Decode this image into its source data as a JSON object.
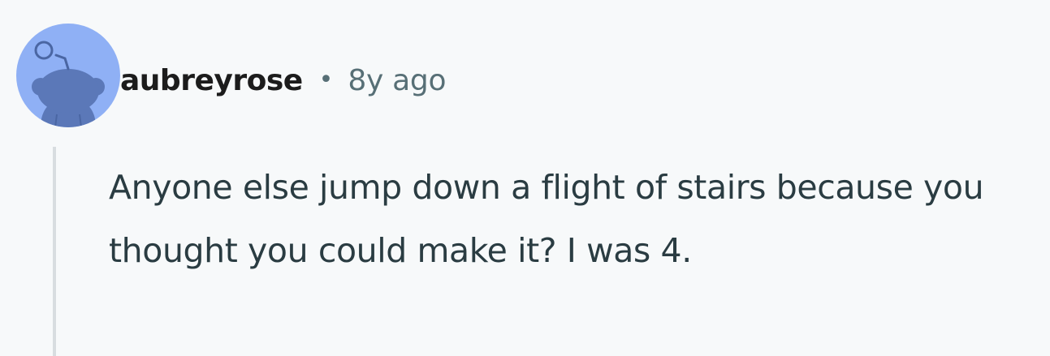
{
  "comment": {
    "author": "aubreyrose",
    "separator": "•",
    "age": "8y ago",
    "body": "Anyone else jump down a flight of stairs because you thought you could make it? I was 4.",
    "avatar_icon": "snoo-avatar-icon"
  },
  "colors": {
    "page_background": "#f7f9fa",
    "avatar_background": "#8fb0f5",
    "avatar_figure": "#5b78b8",
    "username": "#1c1c1c",
    "meta": "#576f76",
    "body_text": "#2a3c42",
    "thread_line": "#d8dde0"
  }
}
